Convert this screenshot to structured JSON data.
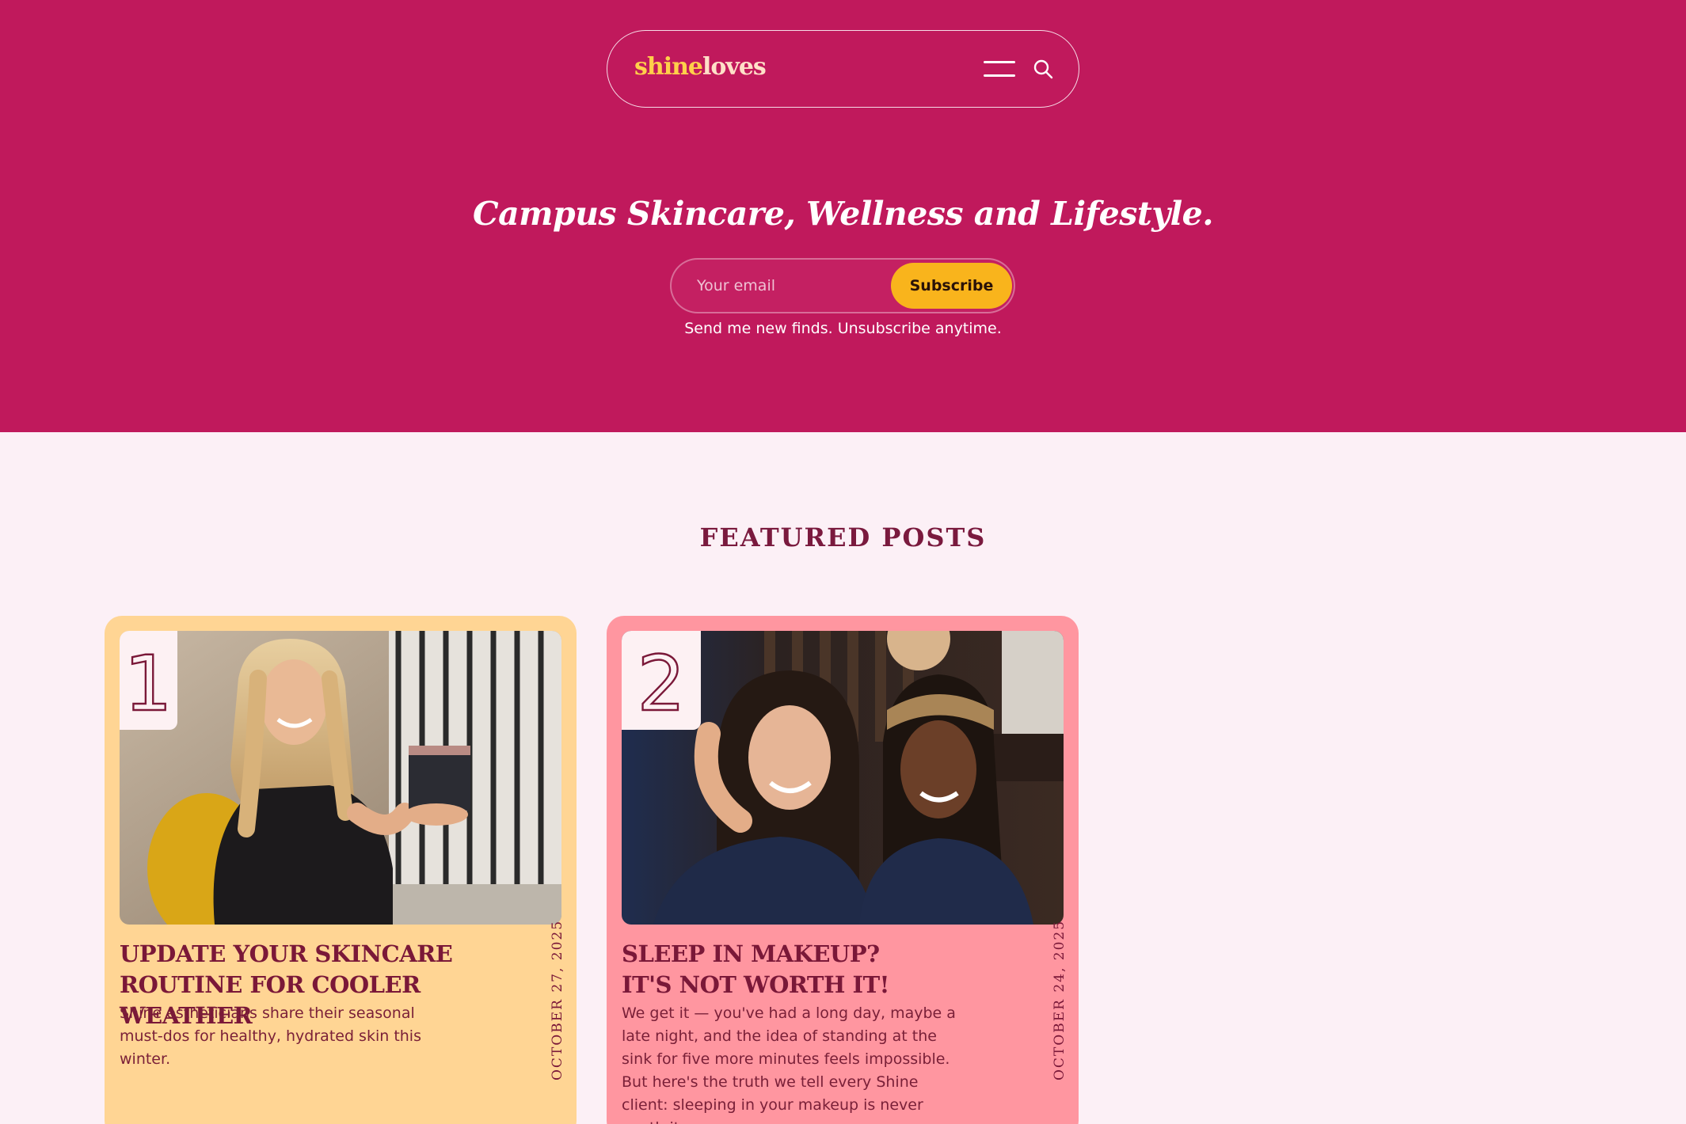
{
  "brand": {
    "logo_part1": "shine",
    "logo_part2": "loves"
  },
  "hero": {
    "tagline": "Campus Skincare, Wellness and Lifestyle.",
    "email_placeholder": "Your email",
    "subscribe_label": "Subscribe",
    "note": "Send me new finds. Unsubscribe anytime."
  },
  "featured": {
    "heading": "FEATURED POSTS",
    "posts": [
      {
        "number": "1",
        "title_lines": [
          "UPDATE YOUR SKINCARE",
          "ROUTINE FOR COOLER WEATHER"
        ],
        "excerpt": "Shine estheticians share their seasonal must-dos for healthy, hydrated skin this winter.",
        "date": "OCTOBER 27, 2025",
        "image_desc_icon": "photo-woman-holding-product"
      },
      {
        "number": "2",
        "title_lines": [
          "SLEEP IN MAKEUP?",
          "IT'S NOT WORTH IT!"
        ],
        "excerpt": "We get it — you've had a long day, maybe a late night, and the idea of standing at the sink for five more minutes feels impossible. But here's the truth we tell every Shine client: sleeping in your makeup is never worth it.",
        "date": "OCTOBER 24, 2025",
        "image_desc_icon": "photo-two-women-smiling"
      }
    ]
  },
  "colors": {
    "hero_bg": "#c0195c",
    "page_bg": "#fcf0f6",
    "accent_yellow": "#f9b41c",
    "card1_bg": "#ffd594",
    "card2_bg": "#ff96a0",
    "title_color": "#7a1838"
  }
}
